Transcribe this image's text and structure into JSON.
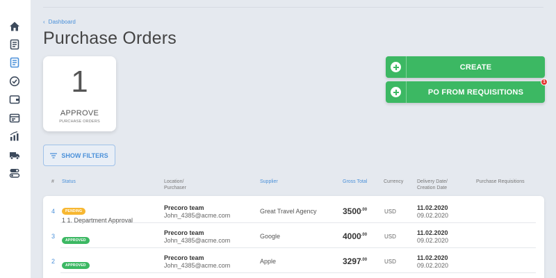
{
  "sidebar": {
    "icons": [
      "home-icon",
      "document-icon",
      "purchase-orders-icon",
      "approvals-check-icon",
      "wallet-icon",
      "invoice-icon",
      "analytics-icon",
      "delivery-truck-icon",
      "settings-toggle-icon"
    ]
  },
  "breadcrumb": {
    "label": "Dashboard"
  },
  "page": {
    "title": "Purchase Orders"
  },
  "approve_card": {
    "count": "1",
    "label": "APPROVE",
    "sublabel": "PURCHASE ORDERS"
  },
  "actions": {
    "create_label": "CREATE",
    "po_from_requisitions_label": "PO FROM REQUISITIONS",
    "po_from_requisitions_badge": "1"
  },
  "filters": {
    "label": "SHOW FILTERS"
  },
  "table": {
    "headers": {
      "num": "#",
      "status": "Status",
      "location_line1": "Location/",
      "location_line2": "Purchaser",
      "supplier": "Supplier",
      "gross_total": "Gross Total",
      "currency": "Currency",
      "dates_line1": "Delivery Date/",
      "dates_line2": "Creation Date",
      "requisitions": "Purchase Requisitions"
    },
    "rows": [
      {
        "num": "4",
        "status": "PENDING",
        "approval": "1 1. Department Approval",
        "location": "Precoro team",
        "email": "John_4385@acme.com",
        "supplier": "Great Travel Agency",
        "total_main": "3500",
        "total_cents": ".00",
        "currency": "USD",
        "delivery_date": "11.02.2020",
        "creation_date": "09.02.2020"
      },
      {
        "num": "3",
        "status": "APPROVED",
        "approval": "",
        "location": "Precoro team",
        "email": "John_4385@acme.com",
        "supplier": "Google",
        "total_main": "4000",
        "total_cents": ".00",
        "currency": "USD",
        "delivery_date": "11.02.2020",
        "creation_date": "09.02.2020"
      },
      {
        "num": "2",
        "status": "APPROVED",
        "approval": "",
        "location": "Precoro team",
        "email": "John_4385@acme.com",
        "supplier": "Apple",
        "total_main": "3297",
        "total_cents": ".00",
        "currency": "USD",
        "delivery_date": "11.02.2020",
        "creation_date": "09.02.2020"
      }
    ]
  },
  "colors": {
    "accent_blue": "#4a90d9",
    "success_green": "#3cb863",
    "pending_yellow": "#f7b731",
    "alert_red": "#e53935",
    "sidebar_icon": "#3d4a5c"
  }
}
